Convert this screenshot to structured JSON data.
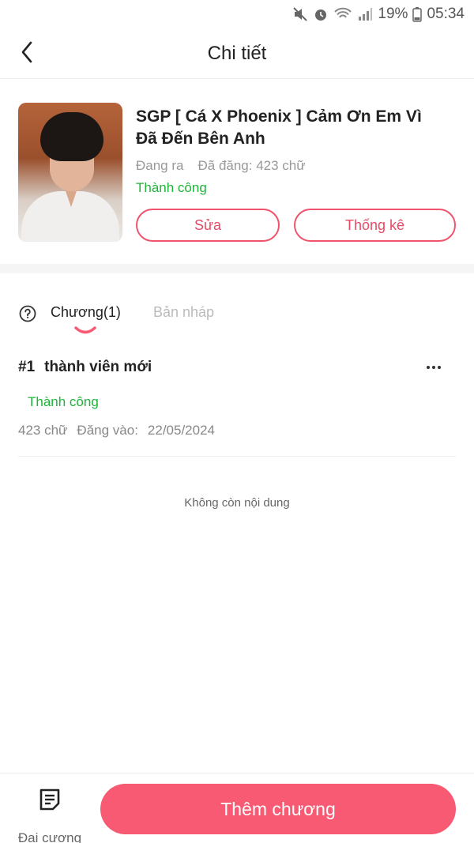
{
  "status_bar": {
    "battery_percent": "19%",
    "time": "05:34",
    "icons": [
      "mute-icon",
      "alarm-icon",
      "wifi-icon",
      "signal-icon",
      "battery-icon"
    ]
  },
  "header": {
    "title": "Chi tiết",
    "back_icon": "chevron-left-icon"
  },
  "story": {
    "title": "SGP [ Cá X Phoenix ] Cảm Ơn Em Vì Đã Đến Bên Anh",
    "ongoing": "Đang ra",
    "posted_words": "Đã đăng: 423 chữ",
    "status": "Thành công",
    "edit_label": "Sửa",
    "stats_label": "Thống kê"
  },
  "tabs": {
    "help_icon": "question-circle-icon",
    "chapters_label": "Chương(1)",
    "drafts_label": "Bản nháp"
  },
  "chapters": [
    {
      "number": "#1",
      "title": "thành viên mới",
      "status": "Thành công",
      "words": "423 chữ",
      "posted_label": "Đăng vào:",
      "date": "22/05/2024"
    }
  ],
  "empty_message": "Không còn nội dung",
  "bottom": {
    "outline_label": "Đại cương",
    "outline_icon": "document-icon",
    "add_chapter_label": "Thêm chương"
  },
  "colors": {
    "accent": "#f75a72",
    "success": "#1fb43a"
  }
}
